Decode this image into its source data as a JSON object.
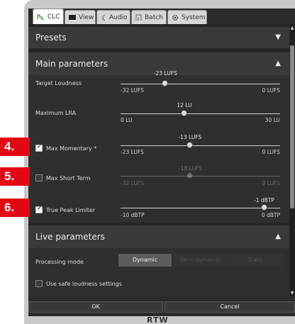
{
  "tabs": [
    {
      "label": "CLC",
      "icon": "clc-icon",
      "active": true
    },
    {
      "label": "View",
      "icon": "monitor-icon"
    },
    {
      "label": "Audio",
      "icon": "audio-icon"
    },
    {
      "label": "Batch",
      "icon": "batch-icon"
    },
    {
      "label": "System",
      "icon": "gear-icon"
    }
  ],
  "presets": {
    "title": "Presets"
  },
  "main": {
    "title": "Main parameters",
    "target": {
      "label": "Target Loudness",
      "value": "-23 LUFS",
      "min": "-32 LUFS",
      "max": "0 LUFS",
      "level": -23,
      "range": [
        -32,
        0
      ]
    },
    "lra": {
      "label": "Maximum LRA",
      "value": "12 LU",
      "min": "0 LU",
      "max": "30 LU",
      "level": 12,
      "range": [
        0,
        30
      ]
    },
    "momentary": {
      "label": "Max Momentary *",
      "checked": true,
      "value": "-13 LUFS",
      "min": "-23 LUFS",
      "max": "0 LUFS",
      "level": -13,
      "range": [
        -23,
        0
      ]
    },
    "shortterm": {
      "label": "Max Short Term",
      "checked": false,
      "value": "-18 LUFS",
      "min": "-32 LUFS",
      "max": "0 LUFS",
      "level": -18,
      "range": [
        -32,
        0
      ]
    },
    "truepeak": {
      "label": "True Peak Limiter",
      "checked": true,
      "value": "-1 dBTP",
      "min": "-10 dBTP",
      "max": "0 dBTP",
      "level": -1,
      "range": [
        -10,
        0
      ]
    }
  },
  "live": {
    "title": "Live parameters",
    "mode_label": "Processing mode",
    "modes": [
      "Dynamic",
      "Semi-dynamic",
      "Static"
    ],
    "active_mode": "Dynamic",
    "safe_label": "Use safe loudness settings",
    "safe_checked": false
  },
  "buttons": {
    "ok": "OK",
    "cancel": "Cancel"
  },
  "brand": "RTW",
  "steps": [
    "4.",
    "5.",
    "6."
  ],
  "colors": {
    "step_marker": "#e30613",
    "panel": "#2f2f2f",
    "header": "#3a3a3a"
  }
}
